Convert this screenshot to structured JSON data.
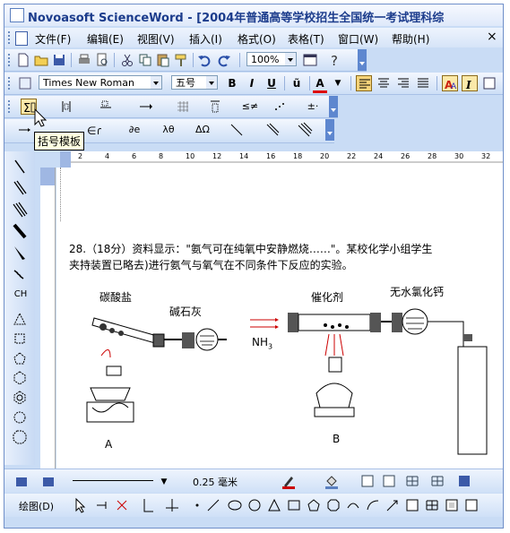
{
  "window": {
    "title": "Novoasoft ScienceWord - [2004年普通高等学校招生全国统一考试理科综"
  },
  "menu": [
    "文件(F)",
    "编辑(E)",
    "视图(V)",
    "插入(I)",
    "格式(O)",
    "表格(T)",
    "窗口(W)",
    "帮助(H)"
  ],
  "standard_toolbar": {
    "zoom": "100%"
  },
  "format_toolbar": {
    "font": "Times New Roman",
    "size": "五号",
    "bold": "B",
    "italic": "I",
    "underline": "U",
    "special": "ũ",
    "font_color": "A"
  },
  "math_toolbar": {
    "neq": "≤≠",
    "plusminus": "±·",
    "partial": "∂e",
    "lambda": "λθ",
    "omega": "ΔΩ"
  },
  "tooltip": "括号模板",
  "ruler_numbers": [
    "2",
    "4",
    "6",
    "8",
    "10",
    "12",
    "14",
    "16",
    "18",
    "20",
    "22",
    "24",
    "26",
    "28",
    "30",
    "32"
  ],
  "document": {
    "line1": "28.（18分）资料显示：\"氨气可在纯氧中安静燃烧……\"。某校化学小组学生",
    "line2": "夹持装置已略去)进行氨气与氧气在不同条件下反应的实验。",
    "label_carbonate": "碳酸盐",
    "label_sodalime": "碱石灰",
    "label_catalyst": "催化剂",
    "label_anhydrous": "无水氯化钙",
    "label_nh3": "NH",
    "label_nh3_sub": "3",
    "label_a": "A",
    "label_b": "B"
  },
  "bottom_toolbar": {
    "line_width": "0.25 毫米"
  },
  "draw_toolbar": {
    "draw": "绘图(D)"
  },
  "left_toolbar": {
    "ch": "CH"
  }
}
